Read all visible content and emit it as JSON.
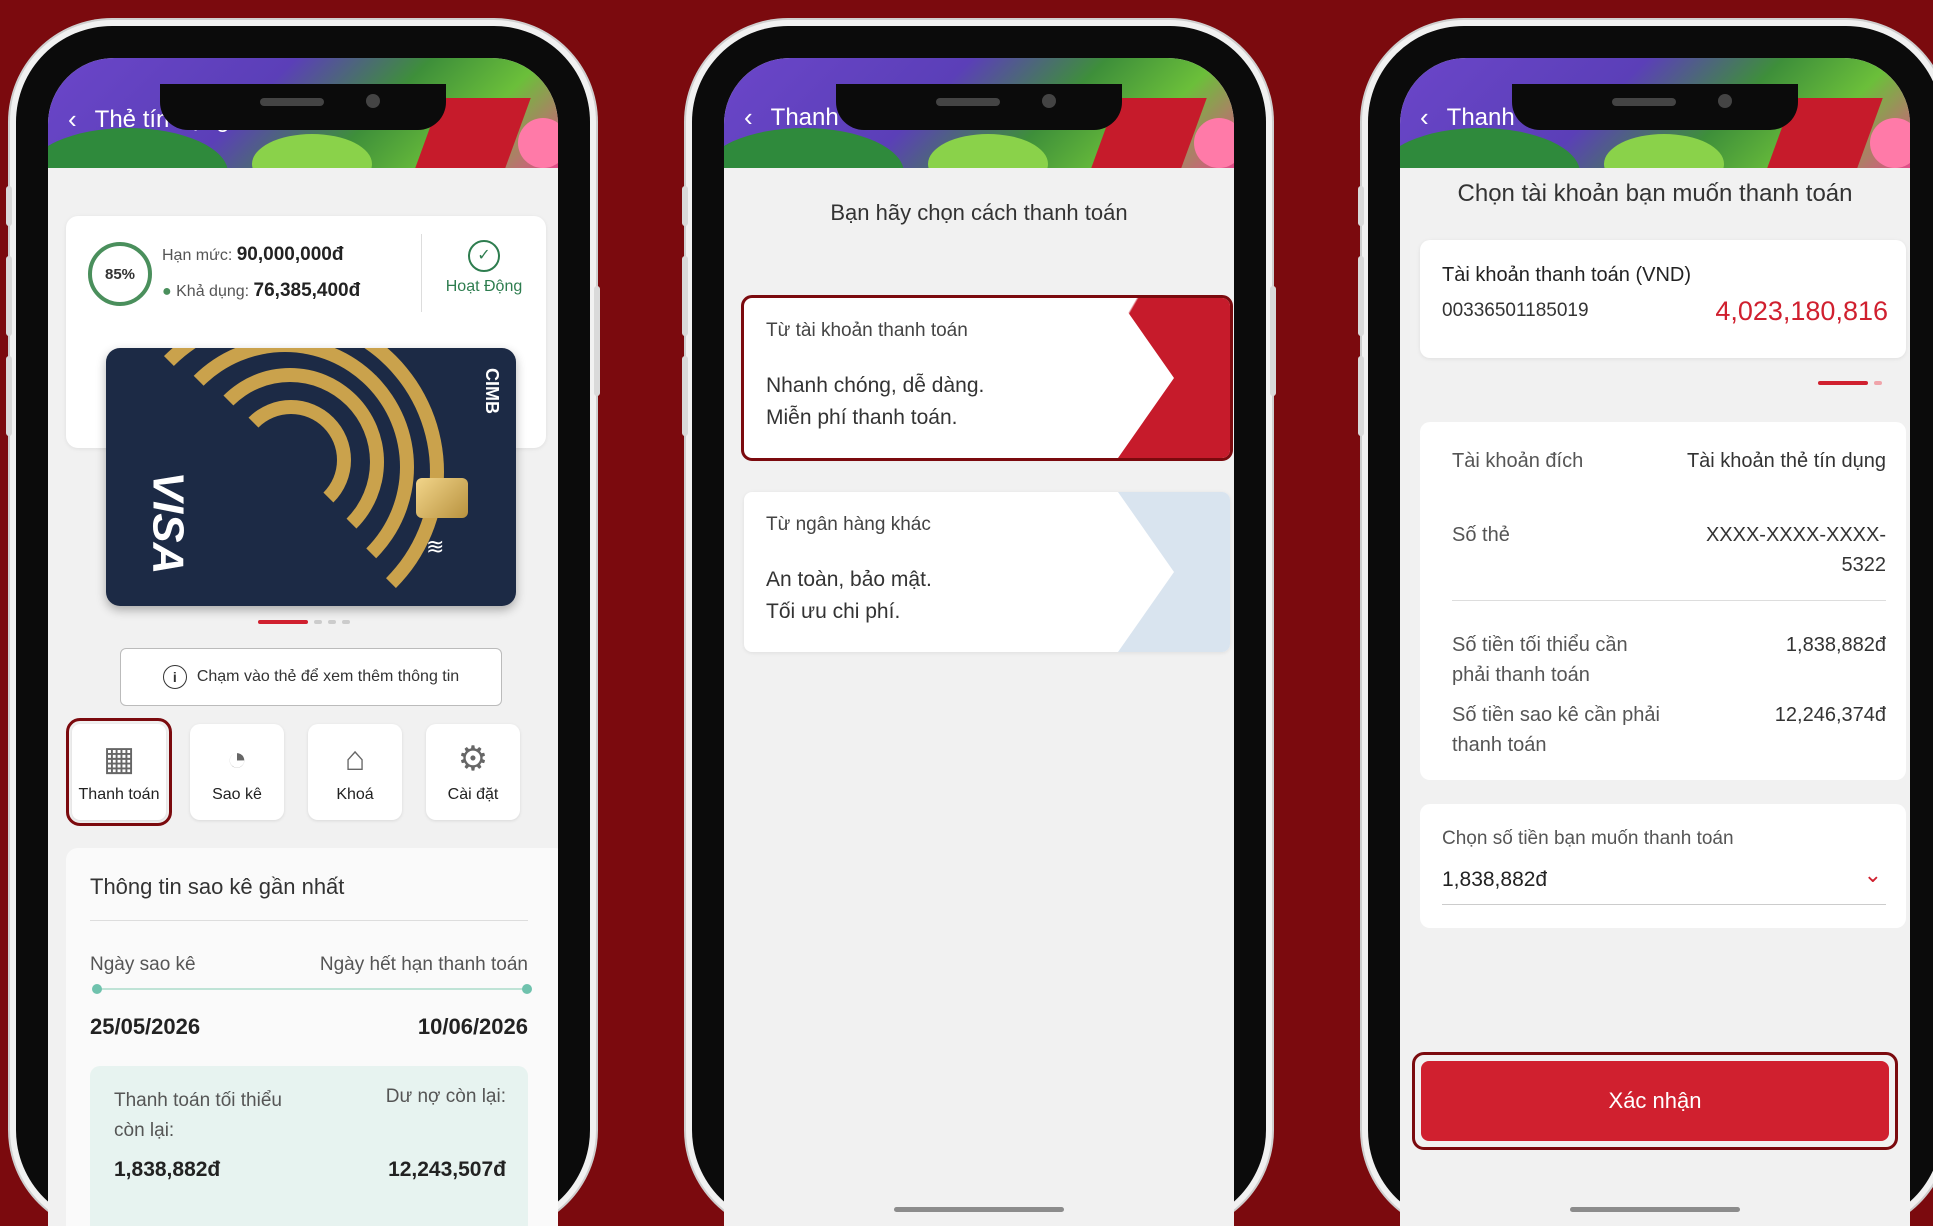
{
  "phone1": {
    "title": "Thẻ tín dụng visa",
    "usage_percent": "85%",
    "limit_label": "Hạn mức:",
    "limit_value": "90,000,000đ",
    "available_label": "Khả dụng:",
    "available_value": "76,385,400đ",
    "status": "Hoạt Động",
    "card_brand": "VISA",
    "card_bank": "CIMB",
    "hint": "Chạm vào thẻ để xem thêm thông tin",
    "actions": [
      {
        "label": "Thanh toán",
        "icon": "payment-icon",
        "selected": true
      },
      {
        "label": "Sao kê",
        "icon": "pie-chart-icon"
      },
      {
        "label": "Khoá",
        "icon": "lock-icon"
      },
      {
        "label": "Cài đặt",
        "icon": "settings-icon"
      }
    ],
    "statement": {
      "title": "Thông tin sao kê gần nhất",
      "statement_date_label": "Ngày sao kê",
      "due_date_label": "Ngày hết hạn thanh toán",
      "statement_date": "25/05/2026",
      "due_date": "10/06/2026",
      "min_remaining_label": "Thanh toán tối thiểu còn lại:",
      "min_remaining_value": "1,838,882đ",
      "debt_remaining_label": "Dư nợ còn lại:",
      "debt_remaining_value": "12,243,507đ"
    }
  },
  "phone2": {
    "title": "Thanh toán",
    "prompt": "Bạn hãy chọn cách thanh toán",
    "options": [
      {
        "title": "Từ tài khoản thanh toán",
        "line1": "Nhanh chóng, dễ dàng.",
        "line2": "Miễn phí thanh toán.",
        "selected": true
      },
      {
        "title": "Từ ngân hàng khác",
        "line1": "An toàn, bảo mật.",
        "line2": "Tối ưu chi phí."
      }
    ]
  },
  "phone3": {
    "title": "Thanh toán từ tk thanh toán",
    "subtitle": "Chọn tài khoản bạn muốn thanh toán",
    "account_name": "Tài khoản thanh toán (VND)",
    "account_number": "00336501185019",
    "account_balance": "4,023,180,816",
    "details": [
      {
        "key": "Tài khoản đích",
        "value": "Tài khoản thẻ tín dụng"
      },
      {
        "key": "Số thẻ",
        "value": "XXXX-XXXX-XXXX-5322"
      },
      {
        "key": "Số tiền tối thiểu cần phải thanh toán",
        "value": "1,838,882đ"
      },
      {
        "key": "Số tiền sao kê cần phải thanh toán",
        "value": "12,246,374đ"
      }
    ],
    "amount_label": "Chọn số tiền bạn muốn thanh toán",
    "amount_value": "1,838,882đ",
    "confirm_label": "Xác nhận"
  },
  "colors": {
    "background": "#7b0a0e",
    "accent": "#d0202f",
    "status_green": "#2e7d4f"
  }
}
